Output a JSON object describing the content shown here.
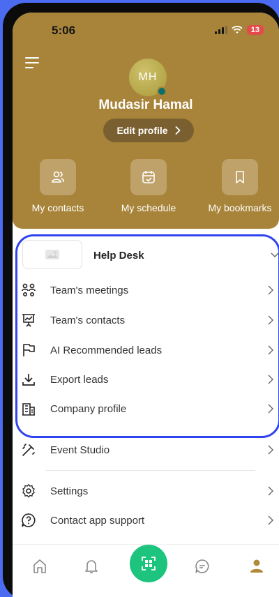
{
  "status": {
    "time": "5:06",
    "battery": "13"
  },
  "profile": {
    "initials": "MH",
    "name": "Mudasir Hamal",
    "edit_label": "Edit profile"
  },
  "quick_actions": [
    {
      "label": "My contacts",
      "icon": "contacts-icon"
    },
    {
      "label": "My schedule",
      "icon": "calendar-check-icon"
    },
    {
      "label": "My bookmarks",
      "icon": "bookmark-icon"
    }
  ],
  "company": {
    "name": "Help Desk"
  },
  "company_menu": [
    {
      "label": "Team's meetings",
      "icon": "team-meetings-icon"
    },
    {
      "label": "Team's contacts",
      "icon": "presentation-board-icon"
    },
    {
      "label": "AI Recommended leads",
      "icon": "flag-icon"
    },
    {
      "label": "Export leads",
      "icon": "download-icon"
    },
    {
      "label": "Company profile",
      "icon": "building-icon"
    }
  ],
  "menu": [
    {
      "label": "Event Studio",
      "icon": "magic-wand-icon"
    },
    {
      "label": "Settings",
      "icon": "gear-icon"
    },
    {
      "label": "Contact app support",
      "icon": "help-circle-icon"
    }
  ],
  "colors": {
    "header": "#a8843a",
    "accent_green": "#1cc47e",
    "highlight_border": "#2f44ee"
  }
}
